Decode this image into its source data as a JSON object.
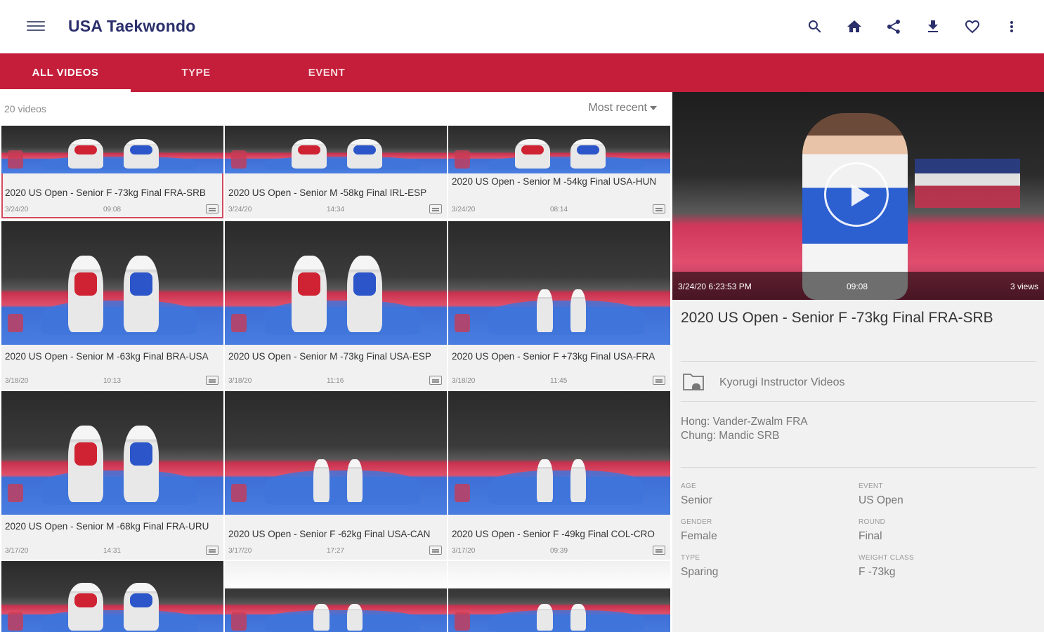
{
  "app": {
    "title": "USA Taekwondo"
  },
  "tabs": [
    {
      "label": "ALL VIDEOS",
      "active": true
    },
    {
      "label": "TYPE",
      "active": false
    },
    {
      "label": "EVENT",
      "active": false
    }
  ],
  "list": {
    "count_label": "20 videos",
    "sort_label": "Most recent",
    "videos": [
      {
        "title": "2020 US Open - Senior F -73kg Final FRA-SRB",
        "date": "3/24/20",
        "duration": "09:08",
        "selected": true,
        "scene": "crop"
      },
      {
        "title": "2020 US Open - Senior M -58kg Final IRL-ESP",
        "date": "3/24/20",
        "duration": "14:34",
        "selected": false,
        "scene": "crop"
      },
      {
        "title": "2020 US Open - Senior M -54kg Final USA-HUN",
        "date": "3/24/20",
        "duration": "08:14",
        "selected": false,
        "scene": "crop"
      },
      {
        "title": "2020 US Open - Senior M -63kg Final BRA-USA",
        "date": "3/18/20",
        "duration": "10:13",
        "selected": false,
        "scene": "close"
      },
      {
        "title": "2020 US Open - Senior M -73kg Final USA-ESP",
        "date": "3/18/20",
        "duration": "11:16",
        "selected": false,
        "scene": "close"
      },
      {
        "title": "2020 US Open - Senior F +73kg Final USA-FRA",
        "date": "3/18/20",
        "duration": "11:45",
        "selected": false,
        "scene": "wide"
      },
      {
        "title": "2020 US Open - Senior M -68kg Final FRA-URU",
        "date": "3/17/20",
        "duration": "14:31",
        "selected": false,
        "scene": "action"
      },
      {
        "title": "2020 US Open - Senior F -62kg Final USA-CAN",
        "date": "3/17/20",
        "duration": "17:27",
        "selected": false,
        "scene": "wide"
      },
      {
        "title": "2020 US Open - Senior F -49kg Final COL-CRO",
        "date": "3/17/20",
        "duration": "09:39",
        "selected": false,
        "scene": "wide"
      },
      {
        "title": "",
        "date": "",
        "duration": "",
        "selected": false,
        "scene": "action"
      },
      {
        "title": "",
        "date": "",
        "duration": "",
        "selected": false,
        "scene": "banner"
      },
      {
        "title": "",
        "date": "",
        "duration": "",
        "selected": false,
        "scene": "banner"
      }
    ]
  },
  "detail": {
    "timestamp": "3/24/20 6:23:53 PM",
    "duration": "09:08",
    "views": "3 views",
    "title": "2020 US Open - Senior F -73kg Final FRA-SRB",
    "category": "Kyorugi Instructor Videos",
    "description_line1": "Hong: Vander-Zwalm FRA",
    "description_line2": "Chung: Mandic SRB",
    "attributes": {
      "age": {
        "label": "AGE",
        "value": "Senior"
      },
      "event": {
        "label": "EVENT",
        "value": "US Open"
      },
      "gender": {
        "label": "GENDER",
        "value": "Female"
      },
      "round": {
        "label": "ROUND",
        "value": "Final"
      },
      "type": {
        "label": "TYPE",
        "value": "Sparing"
      },
      "weight_class": {
        "label": "WEIGHT CLASS",
        "value": "F -73kg"
      }
    }
  },
  "colors": {
    "tab_bar": "#c41e3a",
    "title": "#2b2f6b",
    "selected_outline": "#d34a5e"
  },
  "icons": [
    "menu-icon",
    "search-icon",
    "home-icon",
    "share-icon",
    "download-icon",
    "favorite-icon",
    "more-vert-icon",
    "folder-icon",
    "play-icon",
    "closed-caption-icon"
  ]
}
